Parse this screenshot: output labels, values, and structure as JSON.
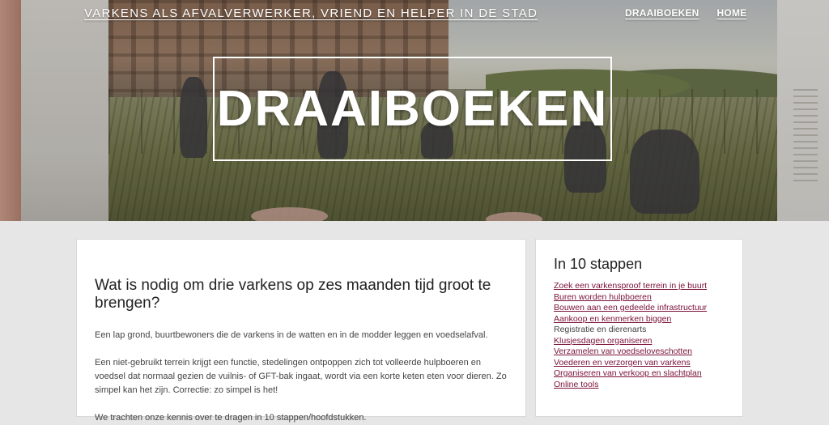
{
  "header": {
    "site_title": "VARKENS ALS AFVALVERWERKER, VRIEND EN HELPER IN DE STAD",
    "nav": [
      {
        "label": "DRAAIBOEKEN"
      },
      {
        "label": "HOME"
      }
    ]
  },
  "hero": {
    "title": "DRAAIBOEKEN"
  },
  "main": {
    "heading": "Wat is nodig om drie varkens op zes maanden tijd groot te brengen?",
    "paragraphs": [
      "Een lap grond, buurtbewoners die de varkens in de watten en in de modder leggen en voedselafval.",
      "Een niet-gebruikt terrein krijgt een functie, stedelingen ontpoppen zich tot volleerde hulpboeren en voedsel dat normaal gezien de vuilnis- of GFT-bak ingaat, wordt via een korte keten eten voor dieren. Zo simpel kan het zijn. Correctie: zo simpel is het!",
      "We trachten onze kennis over te dragen in 10 stappen/hoofdstukken."
    ]
  },
  "sidebar": {
    "title": "In 10 stappen",
    "items": [
      {
        "label": "Zoek een varkensproof terrein in je buurt",
        "link": true
      },
      {
        "label": "Buren worden hulpboeren",
        "link": true
      },
      {
        "label": "Bouwen aan een gedeelde infrastructuur",
        "link": true
      },
      {
        "label": "Aankoop en kenmerken biggen ",
        "link": true
      },
      {
        "label": "Registratie en dierenarts",
        "link": false
      },
      {
        "label": "Klusjesdagen organiseren",
        "link": true
      },
      {
        "label": "Verzamelen van voedseloveschotten",
        "link": true
      },
      {
        "label": "Voederen en verzorgen van varkens",
        "link": true
      },
      {
        "label": "Organiseren van verkoop en slachtplan",
        "link": true
      },
      {
        "label": "Online tools",
        "link": true
      }
    ]
  },
  "colors": {
    "link": "#7a1038",
    "page_bg": "#e6e6e6"
  }
}
